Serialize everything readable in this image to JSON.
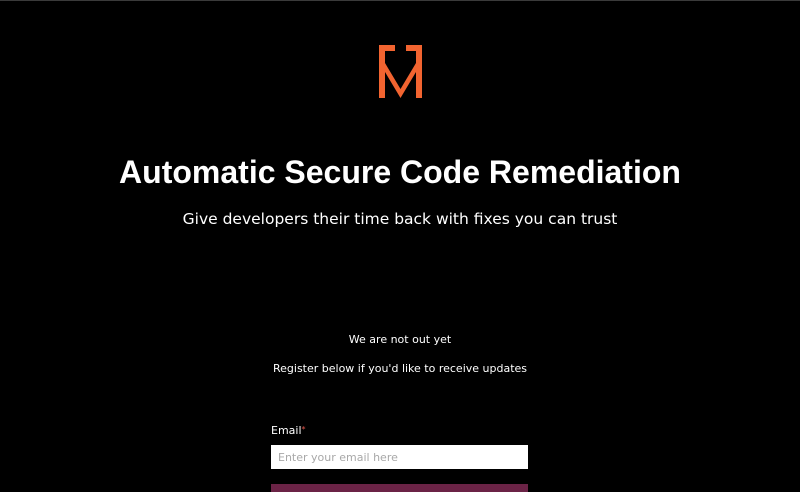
{
  "brand": {
    "logo_icon": "mobb-m-shield-logo",
    "accent_color": "#f26430"
  },
  "hero": {
    "title": "Automatic Secure Code Remediation",
    "subtitle": "Give developers their time back with fixes you can trust"
  },
  "notice": {
    "line1": "We are not out yet",
    "line2": "Register below if you'd like to receive updates"
  },
  "form": {
    "email_label": "Email",
    "required_marker": "*",
    "email_placeholder": "Enter your email here",
    "email_value": "",
    "submit_color": "#6b2346"
  }
}
